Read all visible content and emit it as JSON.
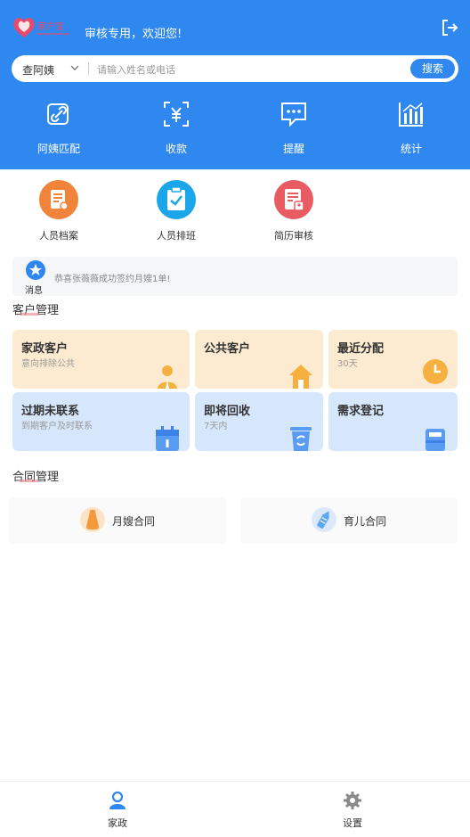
{
  "header": {
    "logo_text": "家户宝",
    "welcome": "审核专用，欢迎您!",
    "brand_color": "#2f87f0"
  },
  "search": {
    "selected_person": "查阿姨",
    "placeholder": "请输入姓名或电话",
    "button": "搜索"
  },
  "top_nav": [
    {
      "label": "阿姨匹配",
      "icon": "link-icon"
    },
    {
      "label": "收款",
      "icon": "yuan-scan-icon"
    },
    {
      "label": "提醒",
      "icon": "chat-icon"
    },
    {
      "label": "统计",
      "icon": "bar-chart-icon"
    }
  ],
  "quick_actions": [
    {
      "label": "人员档案",
      "icon": "profile-file-icon",
      "color": "#f0843a"
    },
    {
      "label": "人员排班",
      "icon": "clipboard-check-icon",
      "color": "#1aa6e8"
    },
    {
      "label": "简历审核",
      "icon": "resume-review-icon",
      "color": "#e85b63"
    }
  ],
  "notice": {
    "tag": "消息",
    "text": "恭喜张薇薇成功签约月嫂1单!"
  },
  "customer_section": {
    "title": "客户管理",
    "cards": [
      {
        "title": "家政客户",
        "subtitle": "意向排除公共",
        "icon": "person-icon"
      },
      {
        "title": "公共客户",
        "subtitle": "",
        "icon": "house-icon"
      },
      {
        "title": "最近分配",
        "subtitle": "30天",
        "icon": "clock-icon"
      },
      {
        "title": "过期未联系",
        "subtitle": "到期客户及时联系",
        "icon": "calendar-icon"
      },
      {
        "title": "即将回收",
        "subtitle": "7天内",
        "icon": "recycle-bin-icon"
      },
      {
        "title": "需求登记",
        "subtitle": "",
        "icon": "register-box-icon"
      }
    ]
  },
  "contract_section": {
    "title": "合同管理",
    "items": [
      {
        "label": "月嫂合同",
        "icon": "bottle-icon"
      },
      {
        "label": "育儿合同",
        "icon": "feeding-bottle-icon"
      }
    ]
  },
  "tabbar": [
    {
      "label": "家政",
      "icon": "person-tab-icon",
      "active": true
    },
    {
      "label": "设置",
      "icon": "gear-icon",
      "active": false
    }
  ]
}
